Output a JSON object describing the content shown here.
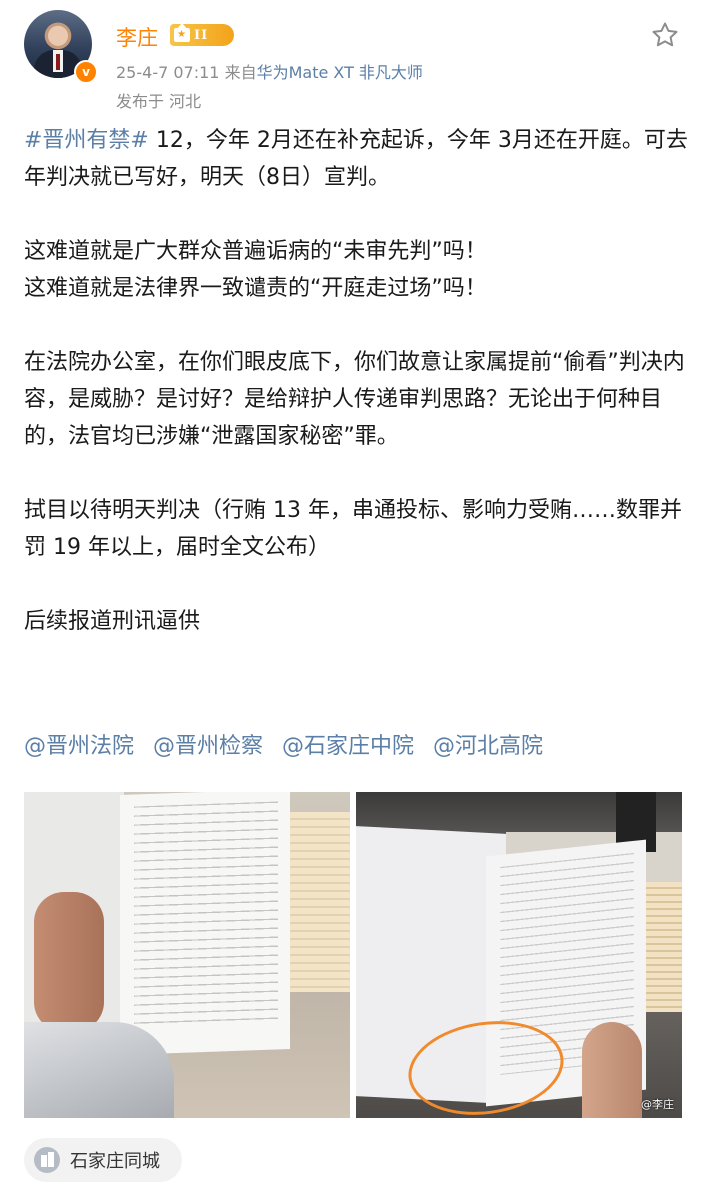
{
  "author": {
    "name": "李庄",
    "verified_badge": "v",
    "level_badge": "II",
    "avatar_icon": "avatar-photo-man-in-suit"
  },
  "meta": {
    "time": "25-4-7 07:11",
    "source_prefix": "来自",
    "device": "华为Mate XT 非凡大师",
    "location": "发布于 河北"
  },
  "post": {
    "tag": "#晋州有禁#",
    "p1_rest": " 12，今年 2月还在补充起诉，今年 3月还在开庭。可去年判决就已写好，明天（8日）宣判。",
    "p2_line1": "这难道就是广大群众普遍诟病的“未审先判”吗！",
    "p2_line2": "这难道就是法律界一致谴责的“开庭走过场”吗！",
    "p3": "在法院办公室，在你们眼皮底下，你们故意让家属提前“偷看”判决内容，是威胁？是讨好？是给辩护人传递审判思路？无论出于何种目的，法官均已涉嫌“泄露国家秘密”罪。",
    "p4": "拭目以待明天判决（行贿 13 年，串通投标、影响力受贿……数罪并罚 19 年以上，届时全文公布）",
    "p5": "后续报道刑讯逼供",
    "mentions": [
      "@晋州法院",
      "@晋州检察",
      "@石家庄中院",
      "@河北高院"
    ]
  },
  "images": {
    "watermark": "@李庄"
  },
  "location_pill": {
    "label": "石家庄同城",
    "icon": "city-buildings-icon"
  },
  "colors": {
    "name": "#ff8200",
    "link": "#5b7fa6",
    "meta": "#8c8c8c",
    "circle_annotation": "#f08a2c"
  }
}
